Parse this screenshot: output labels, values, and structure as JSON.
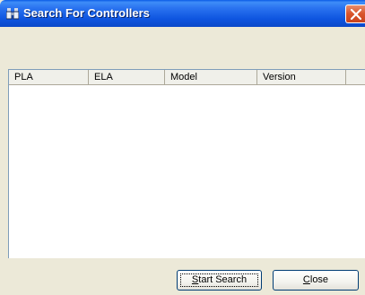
{
  "window": {
    "title": "Search For Controllers",
    "app_icon": "binoculars-icon",
    "close_icon": "close-icon"
  },
  "list": {
    "columns": [
      "PLA",
      "ELA",
      "Model",
      "Version"
    ],
    "rows": []
  },
  "buttons": {
    "start_search": {
      "mnemonic": "S",
      "rest": "tart Search"
    },
    "close": {
      "mnemonic": "C",
      "rest": "lose"
    }
  }
}
